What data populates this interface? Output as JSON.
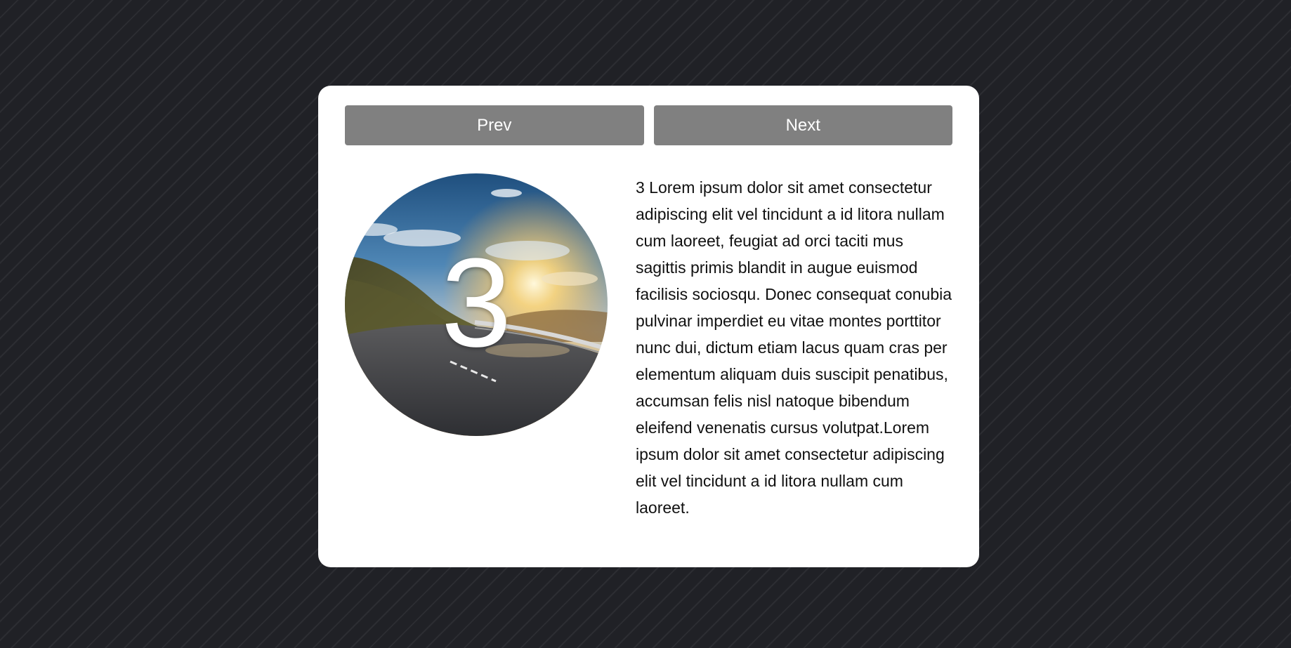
{
  "nav": {
    "prev_label": "Prev",
    "next_label": "Next"
  },
  "slide": {
    "number": "3",
    "image": "mountain-road-sunset-photo",
    "text": "3 Lorem ipsum dolor sit amet consectetur adipiscing elit vel tincidunt a id litora nullam cum laoreet, feugiat ad orci taciti mus sagittis primis blandit in augue euismod facilisis sociosqu. Donec consequat conubia pulvinar imperdiet eu vitae montes porttitor nunc dui, dictum etiam lacus quam cras per elementum aliquam duis suscipit penatibus, accumsan felis nisl natoque bibendum eleifend venenatis cursus volutpat.Lorem ipsum dolor sit amet consectetur adipiscing elit vel tincidunt a id litora nullam cum laoreet."
  },
  "colors": {
    "background": "#202126",
    "card": "#ffffff",
    "button": "#808080",
    "button_text": "#ffffff"
  }
}
